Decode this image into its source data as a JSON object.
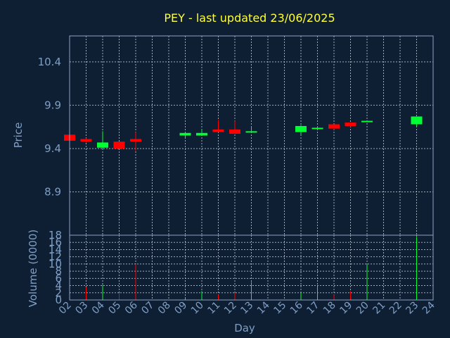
{
  "chart_data": {
    "type": "candlestick",
    "title": "PEY - last updated 23/06/2025",
    "xlabel": "Day",
    "price_axis": {
      "label": "Price",
      "ticks": [
        8.9,
        9.4,
        9.9,
        10.4
      ],
      "ylim": [
        8.4,
        10.7
      ],
      "grid": true
    },
    "volume_axis": {
      "label": "Volume (0000)",
      "ticks": [
        0,
        2,
        4,
        6,
        8,
        10,
        12,
        14,
        16,
        18
      ],
      "ylim": [
        0,
        18
      ],
      "grid": true
    },
    "x_ticks": [
      "02",
      "03",
      "04",
      "05",
      "06",
      "07",
      "08",
      "09",
      "10",
      "11",
      "12",
      "13",
      "14",
      "15",
      "16",
      "17",
      "18",
      "19",
      "20",
      "21",
      "22",
      "23",
      "24"
    ],
    "colors": {
      "up": "#00ff33",
      "down": "#ff0000",
      "title": "#ffff33",
      "axis_text": "#7f9fc6",
      "background": "#0f1f33"
    },
    "candles": [
      {
        "day": 2,
        "open": 9.56,
        "close": 9.49,
        "high": 9.56,
        "low": 9.49,
        "volume": 0
      },
      {
        "day": 3,
        "open": 9.51,
        "close": 9.48,
        "high": 9.52,
        "low": 9.47,
        "volume": 3.5
      },
      {
        "day": 4,
        "open": 9.41,
        "close": 9.47,
        "high": 9.6,
        "low": 9.39,
        "volume": 4.2
      },
      {
        "day": 5,
        "open": 9.48,
        "close": 9.4,
        "high": 9.48,
        "low": 9.4,
        "volume": 2.0
      },
      {
        "day": 6,
        "open": 9.51,
        "close": 9.48,
        "high": 9.59,
        "low": 9.37,
        "volume": 10.0
      },
      {
        "day": 9,
        "open": 9.55,
        "close": 9.58,
        "high": 9.59,
        "low": 9.52,
        "volume": 0.8
      },
      {
        "day": 10,
        "open": 9.55,
        "close": 9.58,
        "high": 9.62,
        "low": 9.55,
        "volume": 2.5
      },
      {
        "day": 11,
        "open": 9.62,
        "close": 9.59,
        "high": 9.73,
        "low": 9.59,
        "volume": 1.5
      },
      {
        "day": 12,
        "open": 9.62,
        "close": 9.57,
        "high": 9.72,
        "low": 9.57,
        "volume": 2.0
      },
      {
        "day": 13,
        "open": 9.59,
        "close": 9.6,
        "high": 9.66,
        "low": 9.58,
        "volume": 5.0
      },
      {
        "day": 16,
        "open": 9.59,
        "close": 9.66,
        "high": 9.67,
        "low": 9.56,
        "volume": 2.0
      },
      {
        "day": 17,
        "open": 9.63,
        "close": 9.64,
        "high": 9.66,
        "low": 9.62,
        "volume": 3.5
      },
      {
        "day": 18,
        "open": 9.68,
        "close": 9.63,
        "high": 9.68,
        "low": 9.62,
        "volume": 1.5
      },
      {
        "day": 19,
        "open": 9.7,
        "close": 9.66,
        "high": 9.7,
        "low": 9.65,
        "volume": 2.5
      },
      {
        "day": 20,
        "open": 9.71,
        "close": 9.72,
        "high": 9.72,
        "low": 9.71,
        "volume": 10.0
      },
      {
        "day": 23,
        "open": 9.68,
        "close": 9.77,
        "high": 9.77,
        "low": 9.66,
        "volume": 17.5
      }
    ]
  }
}
